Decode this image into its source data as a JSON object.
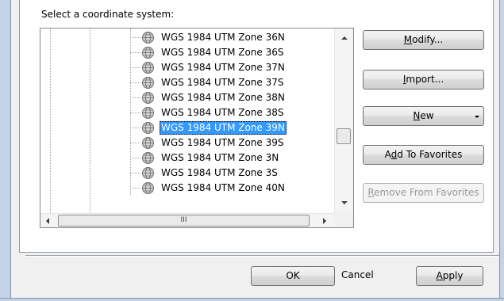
{
  "dialog": {
    "select_label": "Select a coordinate system:"
  },
  "tree": {
    "items": [
      {
        "label": "WGS 1984 UTM Zone 36N",
        "icon": "globe-icon",
        "selected": false
      },
      {
        "label": "WGS 1984 UTM Zone 36S",
        "icon": "globe-icon",
        "selected": false
      },
      {
        "label": "WGS 1984 UTM Zone 37N",
        "icon": "globe-icon",
        "selected": false
      },
      {
        "label": "WGS 1984 UTM Zone 37S",
        "icon": "globe-icon",
        "selected": false
      },
      {
        "label": "WGS 1984 UTM Zone 38N",
        "icon": "globe-icon",
        "selected": false
      },
      {
        "label": "WGS 1984 UTM Zone 38S",
        "icon": "globe-icon",
        "selected": false
      },
      {
        "label": "WGS 1984 UTM Zone 39N",
        "icon": "globe-icon",
        "selected": true
      },
      {
        "label": "WGS 1984 UTM Zone 39S",
        "icon": "globe-icon",
        "selected": false
      },
      {
        "label": "WGS 1984 UTM Zone 3N",
        "icon": "globe-icon",
        "selected": false
      },
      {
        "label": "WGS 1984 UTM Zone 3S",
        "icon": "globe-icon",
        "selected": false
      },
      {
        "label": "WGS 1984 UTM Zone 40N",
        "icon": "globe-icon",
        "selected": false
      }
    ],
    "hscroll_thumb_grip": "III",
    "selection_color": "#3399ff"
  },
  "buttons": {
    "modify": {
      "pre": "",
      "key": "M",
      "post": "odify..."
    },
    "import": {
      "pre": "",
      "key": "I",
      "post": "mport..."
    },
    "new": {
      "pre": "",
      "key": "N",
      "post": "ew"
    },
    "add_favorites": {
      "pre": "A",
      "key": "d",
      "post": "d To Favorites"
    },
    "remove_favorites": {
      "pre": "",
      "key": "R",
      "post": "emove From Favorites",
      "enabled": false
    },
    "ok": "OK",
    "cancel": "Cancel",
    "apply": {
      "pre": "",
      "key": "A",
      "post": "pply"
    }
  }
}
